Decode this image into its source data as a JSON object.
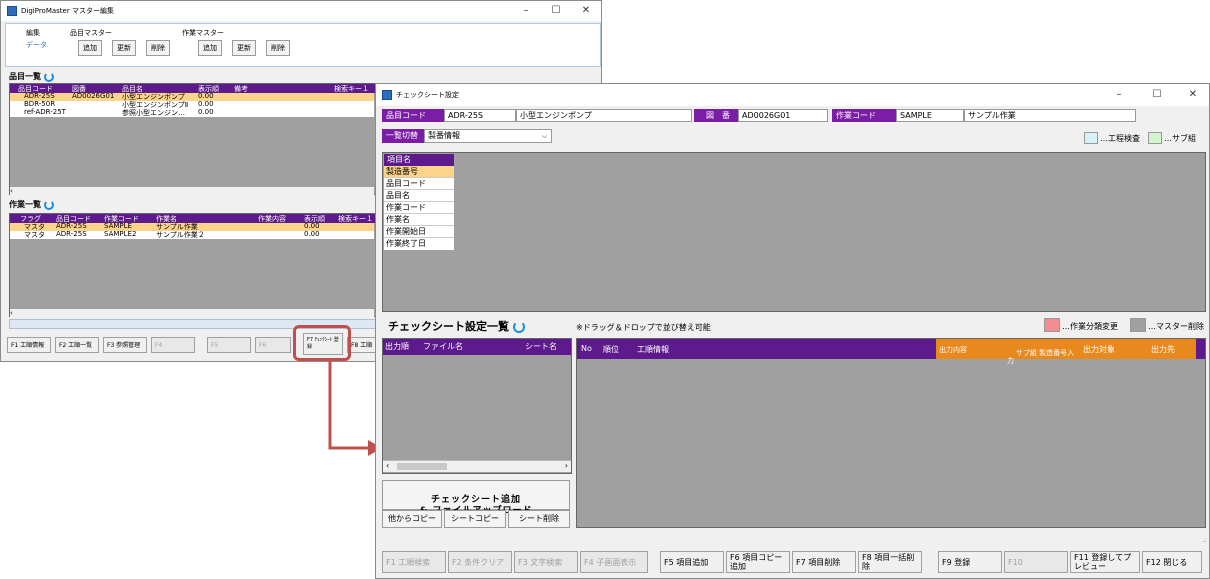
{
  "back_window": {
    "title": "DigiProMaster マスター編集",
    "menu_edit": "編集",
    "menu_data": "データ",
    "item_master": {
      "label": "品目マスター",
      "add": "追加",
      "update": "更新",
      "delete": "削除"
    },
    "work_master": {
      "label": "作業マスター",
      "add": "追加",
      "update": "更新",
      "delete": "削除"
    },
    "item_list": {
      "title": "品目一覧",
      "headers": [
        "品目コード",
        "図番",
        "品目名",
        "表示順",
        "備考",
        "検索キー１"
      ],
      "rows": [
        [
          "ADR-25S",
          "AD0026G01",
          "小型エンジンポンプ",
          "0.00",
          "",
          ""
        ],
        [
          "BDR-50R",
          "",
          "小型エンジンポンプⅡ",
          "0.00",
          "",
          ""
        ],
        [
          "ref-ADR-25T",
          "",
          "参照小型エンジン…",
          "0.00",
          "",
          ""
        ]
      ]
    },
    "work_list": {
      "title": "作業一覧",
      "headers": [
        "フラグ",
        "品目コード",
        "作業コード",
        "作業名",
        "作業内容",
        "表示順",
        "検索キー１"
      ],
      "rows": [
        [
          "マスタ",
          "ADR-25S",
          "SAMPLE",
          "サンプル作業",
          "",
          "0.00",
          ""
        ],
        [
          "マスタ",
          "ADR-25S",
          "SAMPLE2",
          "サンプル作業２",
          "",
          "0.00",
          ""
        ]
      ]
    },
    "fkeys": [
      "F1 工順情報",
      "F2 工順一覧",
      "F3 参照管理",
      "F4",
      "F5",
      "F6",
      "F7 ﾁｪｯｸｼｰﾄ 登録",
      "F8 工順"
    ]
  },
  "front_window": {
    "title": "チェックシート設定",
    "item_code_label": "品目コード",
    "item_code": "ADR-25S",
    "item_name": "小型エンジンポンプ",
    "drawing_label": "図　番",
    "drawing_no": "AD0026G01",
    "work_code_label": "作業コード",
    "work_code": "SAMPLE",
    "work_name": "サンプル作業",
    "switch_label": "一覧切替",
    "switch_value": "製番情報",
    "legend_process": "…工程検査",
    "legend_sub": "…サブ組",
    "field_list": [
      "項目名",
      "製造番号",
      "品目コード",
      "品目名",
      "作業コード",
      "作業名",
      "作業開始日",
      "作業終了日"
    ],
    "checksheet_title": "チェックシート設定一覧",
    "drag_note": "※ドラッグ＆ドロップで並び替え可能",
    "legend_class": "…作業分類変更",
    "legend_master": "…マスター削除",
    "sheet_headers": [
      "出力順",
      "ファイル名",
      "シート名"
    ],
    "step_headers": [
      "No",
      "順位",
      "工順情報",
      "出力内容",
      "サブ組 製造番号入力",
      "出力対象",
      "出力先"
    ],
    "add_button": "チェックシート追加\n& ファイルアップロード",
    "copy_other": "他からコピー",
    "copy_sheet": "シートコピー",
    "delete_sheet": "シート削除",
    "fkeys": [
      "F1 工順検索",
      "F2 条件クリア",
      "F3 文字検索",
      "F4 子画面表示",
      "F5 項目追加",
      "F6 項目コピー追加",
      "F7 項目削除",
      "F8 項目一括削除",
      "F9 登録",
      "F10",
      "F11 登録してプレビュー",
      "F12 閉じる"
    ]
  },
  "colors": {
    "purple": "#5c1a8c",
    "orange": "#e8891e",
    "highlight": "#fbd38a",
    "arrow": "#c0504d",
    "legend_pink": "#f28d92",
    "legend_gray": "#a0a0a0",
    "legend_cyan": "#d5f2f8",
    "legend_green": "#d4f4d0"
  }
}
